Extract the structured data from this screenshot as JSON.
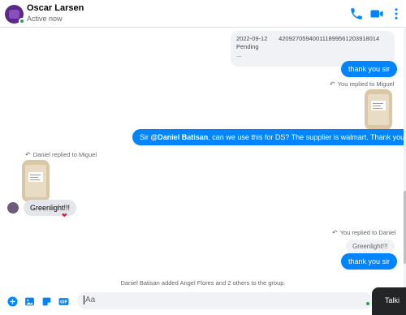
{
  "header": {
    "name": "Oscar Larsen",
    "status": "Active now"
  },
  "messages": {
    "order": {
      "date": "2022-09-12",
      "tracking": "420927059400111899561203918014",
      "status": "Pending",
      "more": "..."
    },
    "thanks_1": "thank you sir",
    "you_replied_miguel": "You replied to Miguel",
    "question_prefix": "Sir ",
    "mention": "@Daniel Batisan",
    "question_suffix": ", can we use this for DS? The supplier is walmart. Thank you",
    "daniel_replied": "Daniel replied to Miguel",
    "greenlight": "Greenlight!!!",
    "reaction": "❤",
    "you_replied_daniel": "You replied to Daniel",
    "quoted_greenlight": "Greenlight!!!",
    "thanks_2": "thank you sir",
    "system": "Daniel Batisan added Angel Flores and 2 others to the group."
  },
  "composer": {
    "placeholder": "Aa",
    "talk_label": "Talki"
  },
  "colors": {
    "accent": "#0084ff",
    "online": "#31a24c",
    "reaction": "#e41e3f"
  },
  "icons": {
    "call": "phone-icon",
    "video": "video-icon",
    "more": "more-icon",
    "plus": "plus-circle-icon",
    "image": "image-icon",
    "sticker": "sticker-icon",
    "gif": "gif-icon"
  }
}
